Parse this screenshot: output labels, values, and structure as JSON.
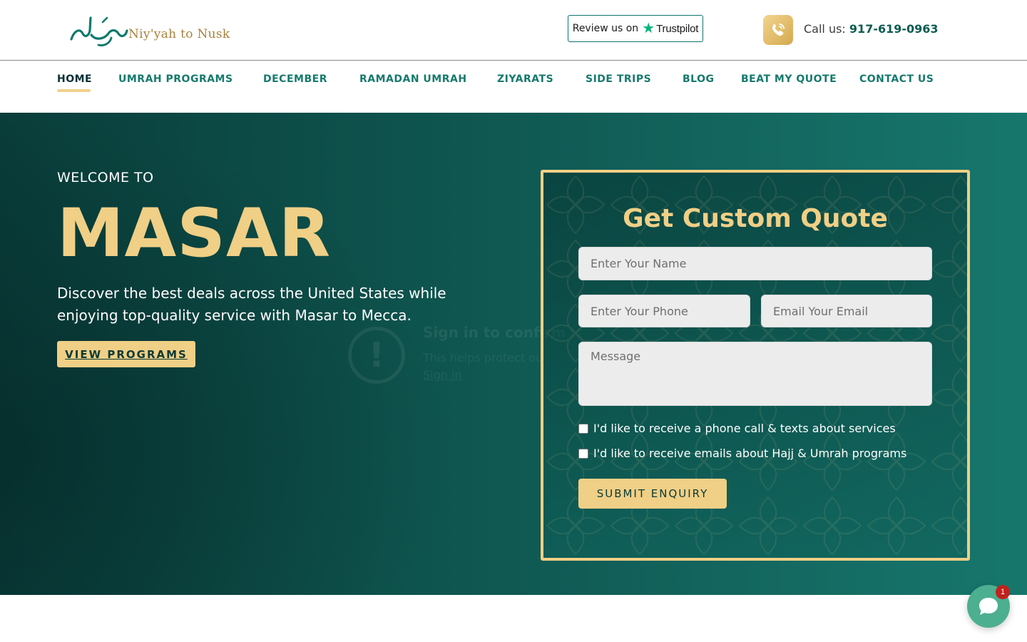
{
  "header": {
    "logo_text": "Niy'yah to Nusk",
    "trustpilot": {
      "review_text": "Review us on",
      "brand": "Trustpilot"
    },
    "phone": {
      "label": "Call us:",
      "number": "917-619-0963"
    }
  },
  "nav": {
    "items": [
      {
        "label": "HOME",
        "active": true
      },
      {
        "label": "UMRAH PROGRAMS"
      },
      {
        "label": "DECEMBER"
      },
      {
        "label": "RAMADAN UMRAH"
      },
      {
        "label": "ZIYARATS"
      },
      {
        "label": "SIDE TRIPS"
      },
      {
        "label": "BLOG"
      },
      {
        "label": "BEAT MY QUOTE"
      },
      {
        "label": "CONTACT US"
      }
    ]
  },
  "hero": {
    "welcome": "WELCOME TO",
    "title": "MASAR",
    "description": "Discover the best deals across the United States while enjoying top-quality service with Masar to Mecca.",
    "cta_label": "VIEW PROGRAMS",
    "ghost_popup": {
      "title": "Sign in to confirm",
      "subtitle": "This helps protect ou",
      "link": "Sign in"
    }
  },
  "quote_form": {
    "title": "Get Custom Quote",
    "name_placeholder": "Enter Your Name",
    "phone_placeholder": "Enter Your Phone",
    "email_placeholder": "Email Your Email",
    "message_placeholder": "Message",
    "checkbox_calls": "I'd like to receive a phone call & texts about services",
    "checkbox_emails": "I'd like to receive emails about Hajj & Umrah programs",
    "submit_label": "SUBMIT ENQUIRY"
  },
  "chat": {
    "badge_count": "1",
    "icon": "chat-bubble-icon"
  },
  "colors": {
    "brand_teal": "#167a6c",
    "hero_dark": "#093d3a",
    "gold": "#f0cf86"
  }
}
